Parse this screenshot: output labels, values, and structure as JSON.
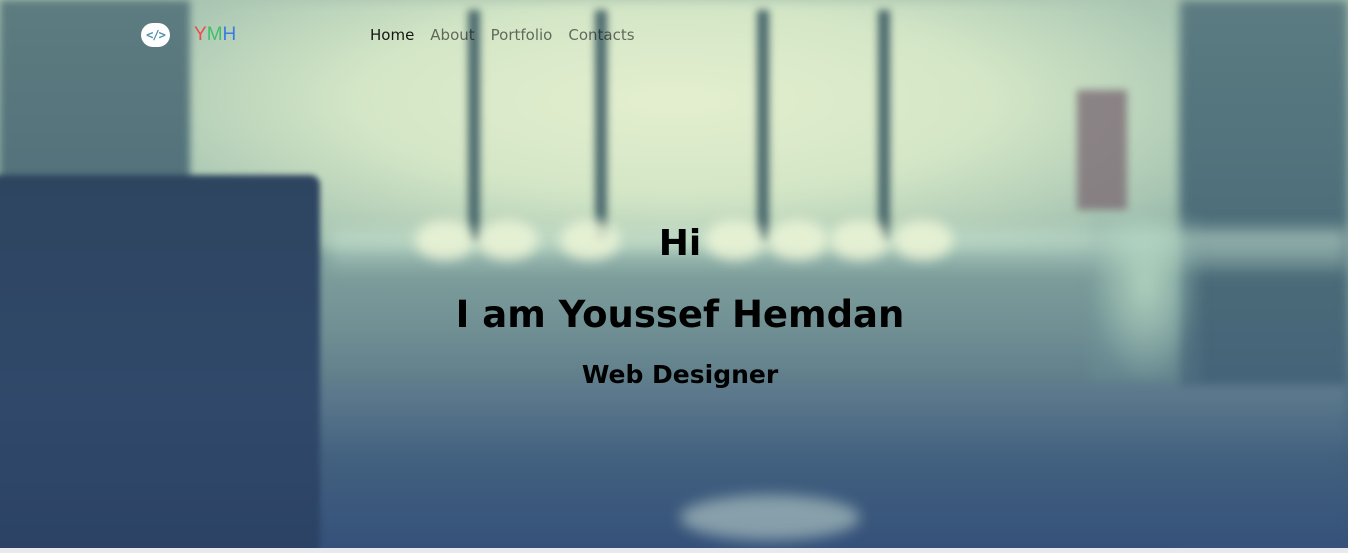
{
  "navbar": {
    "logo_icon": "code-slash-icon",
    "logo_glyph": "</>",
    "brand": {
      "letters": [
        {
          "char": "Y",
          "color": "#ea4c4c"
        },
        {
          "char": "M",
          "color": "#3fbf6a"
        },
        {
          "char": "H",
          "color": "#3a7de0"
        }
      ]
    },
    "links": [
      {
        "label": "Home",
        "active": true
      },
      {
        "label": "About",
        "active": false
      },
      {
        "label": "Portfolio",
        "active": false
      },
      {
        "label": "Contacts",
        "active": false
      }
    ]
  },
  "hero": {
    "greeting": "Hi",
    "headline": "I am Youssef Hemdan",
    "role": "Web Designer"
  }
}
